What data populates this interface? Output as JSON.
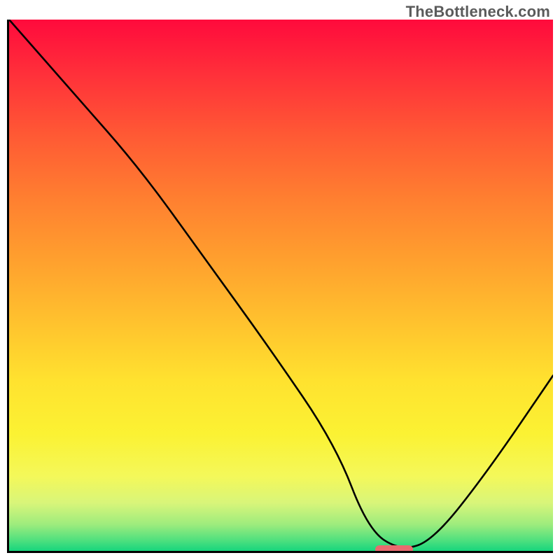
{
  "watermark": "TheBottleneck.com",
  "colors": {
    "axis": "#000000",
    "curve": "#000000",
    "marker": "#e96a6f",
    "gradient_top": "#ff0a3c",
    "gradient_mid": "#ffe22f",
    "gradient_bottom": "#17d57d"
  },
  "marker": {
    "x_pct": 67,
    "width_pct": 7
  },
  "chart_data": {
    "type": "line",
    "title": "",
    "xlabel": "",
    "ylabel": "",
    "xlim": [
      0,
      100
    ],
    "ylim": [
      0,
      100
    ],
    "series": [
      {
        "name": "curve",
        "x": [
          0,
          12,
          24,
          36,
          48,
          60,
          66,
          72,
          78,
          88,
          100
        ],
        "y": [
          100,
          86,
          72,
          55,
          38,
          20,
          4,
          0,
          2,
          15,
          33
        ]
      }
    ],
    "optimum_marker": {
      "x_start": 67,
      "x_end": 74,
      "y": 0
    },
    "notes": "Axes have no tick labels or numeric annotations; values are read as percentages of the plot area. y=0 is the bottom axis, y=100 is the top edge."
  }
}
